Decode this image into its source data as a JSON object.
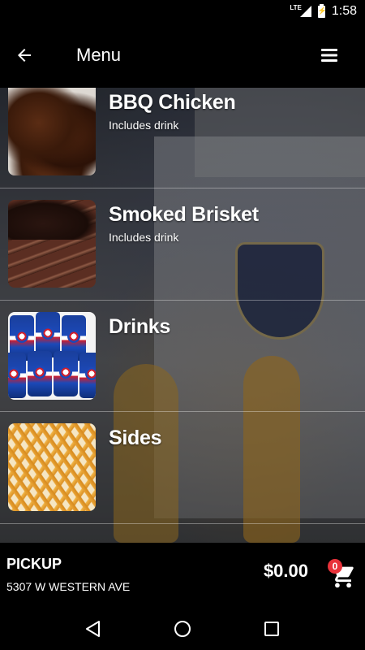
{
  "status_bar": {
    "network": "LTE",
    "time": "1:58"
  },
  "app_bar": {
    "title": "Menu"
  },
  "menu_items": [
    {
      "name": "BBQ Chicken",
      "description": "Includes drink"
    },
    {
      "name": "Smoked Brisket",
      "description": "Includes drink"
    },
    {
      "name": "Drinks",
      "description": ""
    },
    {
      "name": "Sides",
      "description": ""
    }
  ],
  "footer": {
    "mode": "PICKUP",
    "address": "5307 W WESTERN AVE",
    "total": "$0.00",
    "cart_count": "0"
  },
  "icons": {
    "back": "arrow-left-icon",
    "menu": "hamburger-menu-icon",
    "cart": "shopping-cart-icon",
    "nav_back": "triangle-back-icon",
    "nav_home": "circle-home-icon",
    "nav_recents": "square-recents-icon"
  },
  "colors": {
    "badge": "#e8323a",
    "bar_background": "#000000"
  }
}
